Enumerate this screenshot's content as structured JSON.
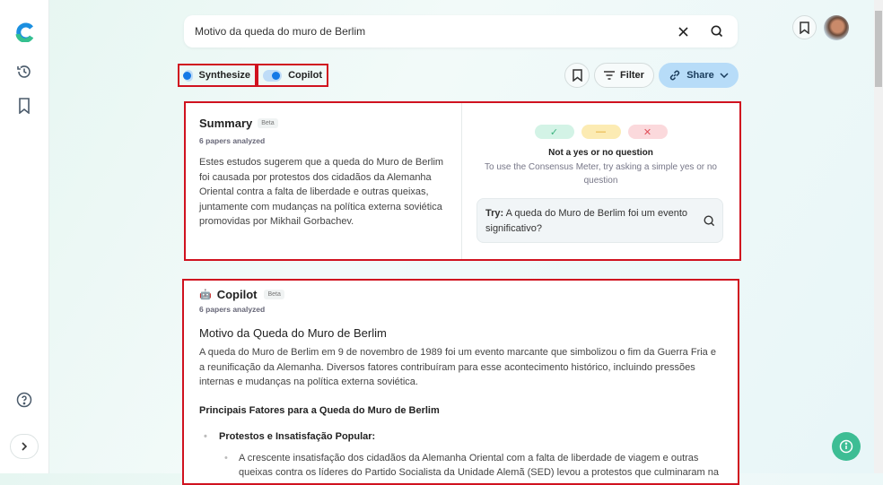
{
  "search": {
    "query": "Motivo da queda do muro de Berlim"
  },
  "toggles": {
    "synthesize": "Synthesize",
    "copilot": "Copilot"
  },
  "toolbar": {
    "filter": "Filter",
    "share": "Share"
  },
  "summary": {
    "title": "Summary",
    "badge": "Beta",
    "papers": "6 papers analyzed",
    "text": "Estes estudos sugerem que a queda do Muro de Berlim foi causada por protestos dos cidadãos da Alemanha Oriental contra a falta de liberdade e outras queixas, juntamente com mudanças na política externa soviética promovidas por Mikhail Gorbachev."
  },
  "meter": {
    "title": "Not a yes or no question",
    "desc": "To use the Consensus Meter, try asking a simple yes or no question",
    "try_label": "Try:",
    "try_text": "A queda do Muro de Berlim foi um evento significativo?",
    "colors": {
      "yes": "#d3f3e6",
      "possibly": "#fcebb3",
      "no": "#fbd9dc"
    }
  },
  "copilot": {
    "title": "Copilot",
    "badge": "Beta",
    "papers": "6 papers analyzed",
    "heading": "Motivo da Queda do Muro de Berlim",
    "intro": "A queda do Muro de Berlim em 9 de novembro de 1989 foi um evento marcante que simbolizou o fim da Guerra Fria e a reunificação da Alemanha. Diversos fatores contribuíram para esse acontecimento histórico, incluindo pressões internas e mudanças na política externa soviética.",
    "subheading": "Principais Fatores para a Queda do Muro de Berlim",
    "bullet": "Protestos e Insatisfação Popular:",
    "subbullet": "A crescente insatisfação dos cidadãos da Alemanha Oriental com a falta de liberdade de viagem e outras queixas contra os líderes do Partido Socialista da Unidade Alemã (SED) levou a protestos que culminaram na"
  }
}
